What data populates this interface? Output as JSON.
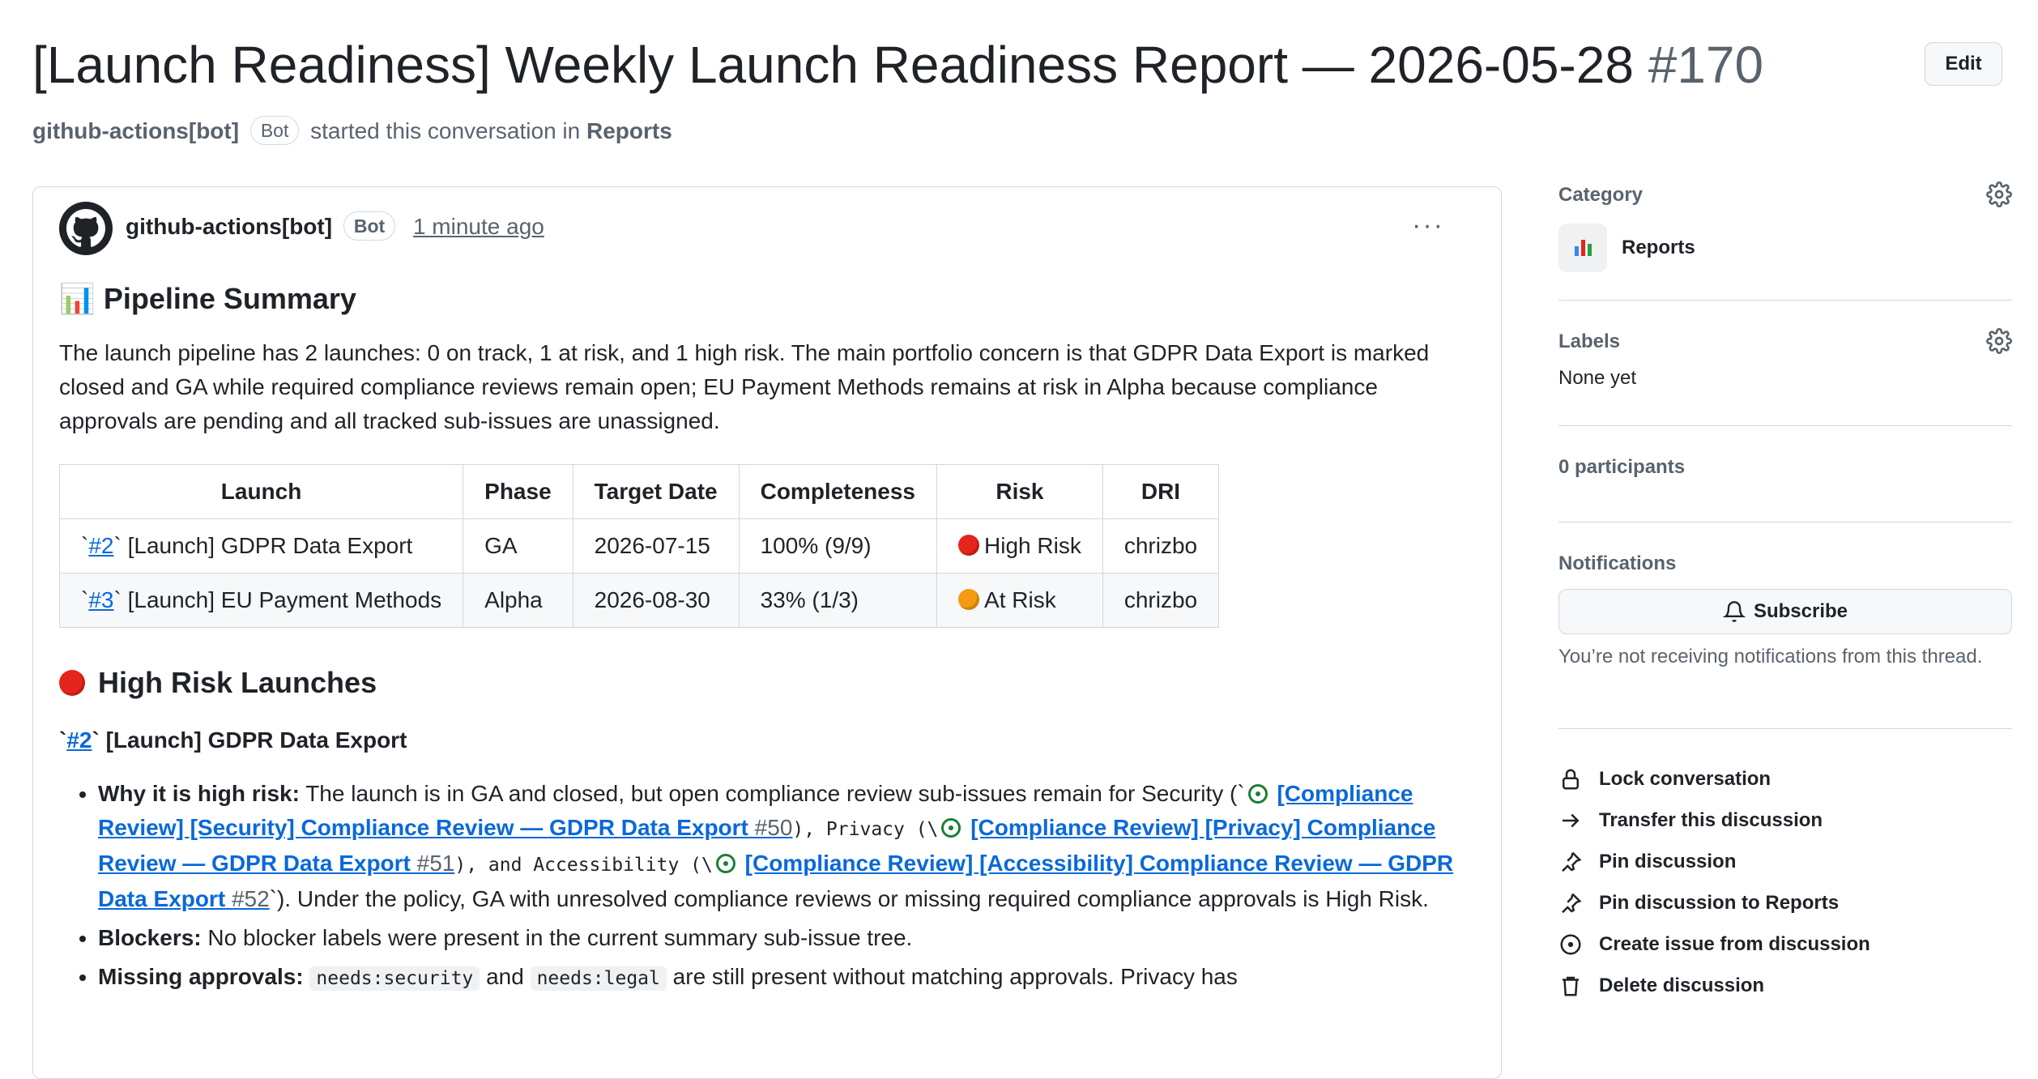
{
  "header": {
    "title": "[Launch Readiness] Weekly Launch Readiness Report — 2026-05-28",
    "number": "#170",
    "edit_label": "Edit",
    "author": "github-actions[bot]",
    "bot_badge": "Bot",
    "started_text": "started this conversation in",
    "category_link": "Reports"
  },
  "comment": {
    "author": "github-actions[bot]",
    "bot_badge": "Bot",
    "time": "1 minute ago",
    "more_label": "···",
    "summary_heading": "📊 Pipeline Summary",
    "summary_text": "The launch pipeline has 2 launches: 0 on track, 1 at risk, and 1 high risk. The main portfolio concern is that GDPR Data Export is marked closed and GA while required compliance reviews remain open; EU Payment Methods remains at risk in Alpha because compliance approvals are pending and all tracked sub-issues are unassigned.",
    "table": {
      "headers": [
        "Launch",
        "Phase",
        "Target Date",
        "Completeness",
        "Risk",
        "DRI"
      ],
      "rows": [
        {
          "issue": "#2",
          "name": "[Launch] GDPR Data Export",
          "phase": "GA",
          "target": "2026-07-15",
          "completeness": "100% (9/9)",
          "risk": "High Risk",
          "risk_color": "#e5241b",
          "dri": "chrizbo"
        },
        {
          "issue": "#3",
          "name": "[Launch] EU Payment Methods",
          "phase": "Alpha",
          "target": "2026-08-30",
          "completeness": "33% (1/3)",
          "risk": "At Risk",
          "risk_color": "#f59a11",
          "dri": "chrizbo"
        }
      ]
    },
    "high_risk_heading": "High Risk Launches",
    "launch_issue": "#2",
    "launch_name": "[Launch] GDPR Data Export",
    "bullets": {
      "b1_label": "Why it is high risk:",
      "b1_text1": "The launch is in GA and closed, but open compliance review sub-issues remain for Security (`",
      "b1_link1": "[Compliance Review] [Security] Compliance Review — GDPR Data Export",
      "b1_num1": "#50",
      "b1_mid1": "), Privacy (\\",
      "b1_link2": "[Compliance Review] [Privacy] Compliance Review — GDPR Data Export",
      "b1_num2": "#51",
      "b1_mid2": "), and Accessibility (\\",
      "b1_link3": "[Compliance Review] [Accessibility] Compliance Review — GDPR Data Export",
      "b1_num3": "#52",
      "b1_text2": "`). Under the policy, GA with unresolved compliance reviews or missing required compliance approvals is High Risk.",
      "b2_label": "Blockers:",
      "b2_text": "No blocker labels were present in the current summary sub-issue tree.",
      "b3_label": "Missing approvals:",
      "b3_code1": "needs:security",
      "b3_and": "and",
      "b3_code2": "needs:legal",
      "b3_text": "are still present without matching approvals. Privacy has"
    }
  },
  "sidebar": {
    "category_title": "Category",
    "category_name": "Reports",
    "labels_title": "Labels",
    "labels_value": "None yet",
    "participants": "0 participants",
    "notifications_title": "Notifications",
    "subscribe_label": "Subscribe",
    "notif_text": "You’re not receiving notifications from this thread.",
    "actions": [
      "Lock conversation",
      "Transfer this discussion",
      "Pin discussion",
      "Pin discussion to Reports",
      "Create issue from discussion",
      "Delete discussion"
    ]
  }
}
